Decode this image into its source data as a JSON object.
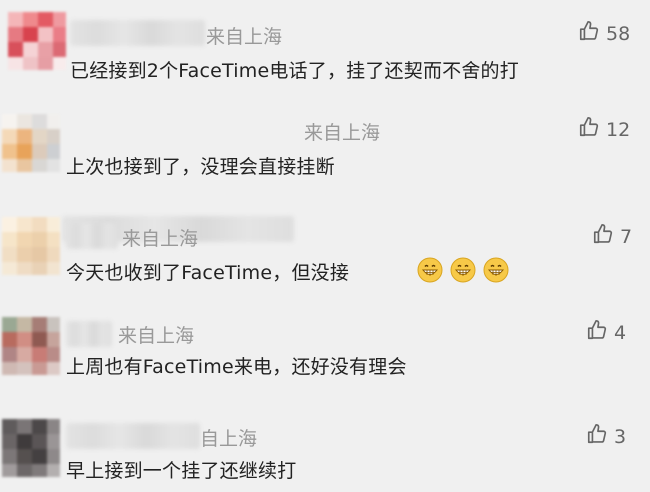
{
  "comments": [
    {
      "location": "来自上海",
      "text": "已经接到2个FaceTime电话了，挂了还契而不舍的打",
      "likes": "58",
      "avatar_colors": [
        "#f4b6b8",
        "#ef8a8d",
        "#e35a63",
        "#ef9aa0",
        "#e67a82",
        "#d8434e",
        "#f3c2c5",
        "#ea7d87",
        "#d8505b",
        "#f5d3d5",
        "#e8a0a6",
        "#dc6a74",
        "#f7e4e5",
        "#efc3c6",
        "#e69ea4",
        "#f8ecec"
      ]
    },
    {
      "location": "来自上海",
      "text": "上次也接到了，没理会直接挂断",
      "likes": "12",
      "avatar_colors": [
        "#f6f3ef",
        "#ebe6e0",
        "#dddcdc",
        "#f1efed",
        "#f4d9b8",
        "#ecb57f",
        "#e3d6c6",
        "#d8d0c8",
        "#f0c28d",
        "#e8a35a",
        "#dccbbb",
        "#cdcfd2",
        "#f3e2cf",
        "#e9c6a0",
        "#d9d7d4",
        "#e2e2e2"
      ]
    },
    {
      "location": "来自上海",
      "text": "今天也收到了FaceTime，但没接",
      "likes": "7",
      "avatar_colors": [
        "#fbf1e2",
        "#f7e6cd",
        "#f2dcc0",
        "#f8edd9",
        "#f6e5c9",
        "#f1d6b1",
        "#ecd0ab",
        "#f4e0c2",
        "#f1dec4",
        "#ebcfac",
        "#e6c8a5",
        "#efd9bd",
        "#f5e9d6",
        "#efdcc4",
        "#e9d2b6",
        "#f2e4d0"
      ]
    },
    {
      "location": "来自上海",
      "text": "上周也有FaceTime来电，还好没有理会",
      "likes": "4",
      "avatar_colors": [
        "#9aa893",
        "#c5b8a4",
        "#a67d76",
        "#c9c3be",
        "#b86b5f",
        "#d18e84",
        "#8f5a52",
        "#c6a49c",
        "#b08585",
        "#d7aaa2",
        "#c87c76",
        "#b98c88",
        "#cfb9b3",
        "#d4c2bd",
        "#c99a94",
        "#dcc9c5"
      ]
    },
    {
      "location": "自上海",
      "text": "早上接到一个挂了还继续打",
      "likes": "3",
      "avatar_colors": [
        "#5f5b5c",
        "#7a7576",
        "#4c4849",
        "#8a8586",
        "#6a6566",
        "#3f3b3c",
        "#5a5556",
        "#9a9596",
        "#7c7778",
        "#55504f",
        "#444041",
        "#8e898a",
        "#a09b9c",
        "#6c6768",
        "#7f7a7b",
        "#b3afaf"
      ]
    }
  ],
  "colors": {
    "background": "#f0f0f0",
    "text": "#222222",
    "meta": "#999999",
    "like": "#666666"
  },
  "icons": {
    "like": "thumbs-up-outline-icon",
    "emoji": "grinning-face-icon"
  }
}
